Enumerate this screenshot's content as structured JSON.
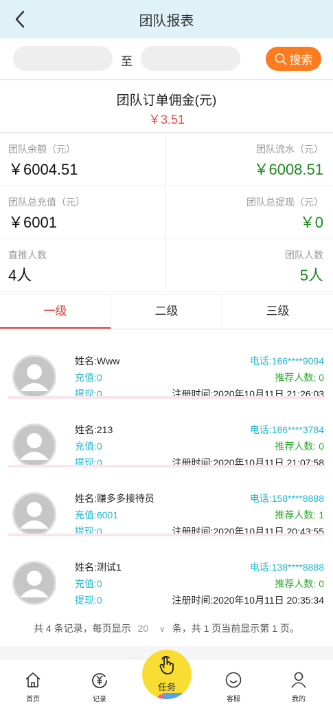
{
  "header": {
    "title": "团队报表",
    "back_icon": "chevron-left-icon"
  },
  "search": {
    "from_value": "",
    "to_label": "至",
    "to_value": "",
    "button_label": "搜索",
    "button_color": "#fb7b1e"
  },
  "commission": {
    "label": "团队订单佣金(元)",
    "value": "￥3.51"
  },
  "stats": [
    {
      "label": "团队余额（元）",
      "value": "￥6004.51"
    },
    {
      "label": "团队流水（元）",
      "value": "￥6008.51"
    },
    {
      "label": "团队总充值（元）",
      "value": "￥6001"
    },
    {
      "label": "团队总提现（元）",
      "value": "￥0"
    },
    {
      "label": "直推人数",
      "value": "4人"
    },
    {
      "label": "团队人数",
      "value": "5人"
    }
  ],
  "tabs": [
    {
      "label": "一级"
    },
    {
      "label": "二级"
    },
    {
      "label": "三级"
    }
  ],
  "members": [
    {
      "name": "姓名:Www",
      "recharge": "充值:0",
      "withdraw": "提现:0",
      "phone": "电话:166****9094",
      "referrals": "推荐人数: 0",
      "registered": "注册时间:2020年10月11日 21:26:03"
    },
    {
      "name": "姓名:213",
      "recharge": "充值:0",
      "withdraw": "提现:0",
      "phone": "电话:186****3784",
      "referrals": "推荐人数: 0",
      "registered": "注册时间:2020年10月11日 21:07:58"
    },
    {
      "name": "姓名:赚多多接待员",
      "recharge": "充值:6001",
      "withdraw": "提现:0",
      "phone": "电话:158****8888",
      "referrals": "推荐人数: 1",
      "registered": "注册时间:2020年10月11日 20:43:55"
    },
    {
      "name": "姓名:测试1",
      "recharge": "充值:0",
      "withdraw": "提现:0",
      "phone": "电话:138****8888",
      "referrals": "推荐人数: 0",
      "registered": "注册时间:2020年10月11日 20:35:34"
    }
  ],
  "pager": {
    "prefix": "共 4 条记录，每页显示",
    "page_size": "20",
    "suffix": "条，共 1 页当前显示第 1 页。"
  },
  "nav": {
    "home": "首页",
    "records": "记录",
    "task": "任务",
    "service": "客服",
    "mine": "我的"
  }
}
